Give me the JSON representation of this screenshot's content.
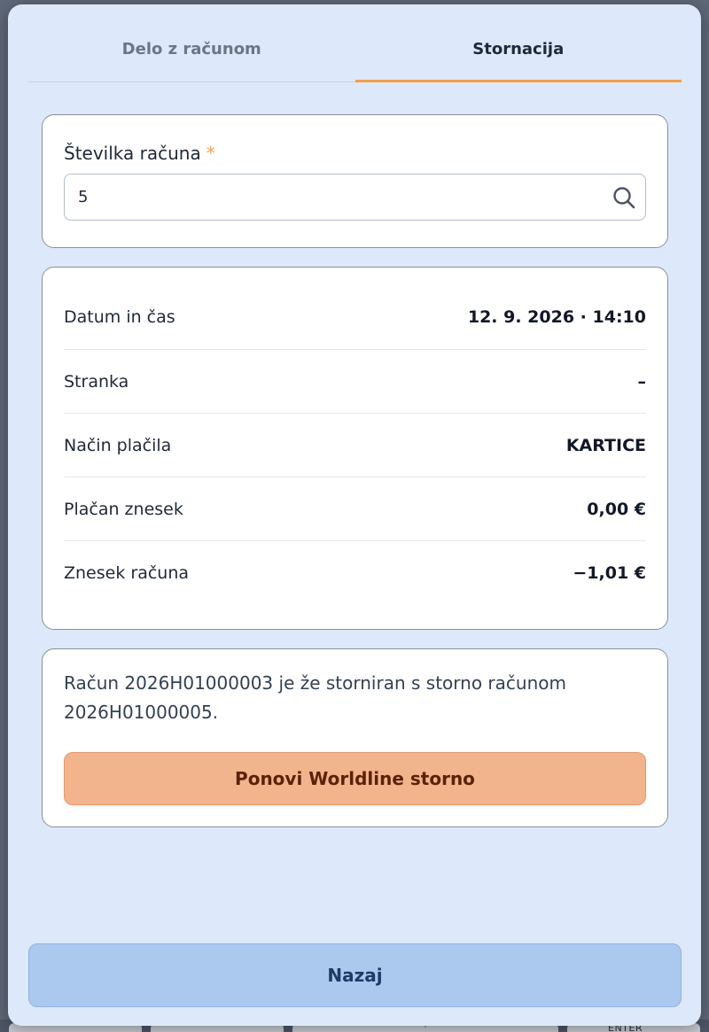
{
  "tabs": [
    {
      "label": "Delo z računom",
      "active": false
    },
    {
      "label": "Stornacija",
      "active": true
    }
  ],
  "search": {
    "label": "Številka računa",
    "required_mark": "*",
    "value": "5",
    "icon": "search-icon"
  },
  "details": {
    "rows": [
      {
        "label": "Datum in čas",
        "value": "12. 9. 2026 · 14:10"
      },
      {
        "label": "Stranka",
        "value": "–"
      },
      {
        "label": "Način plačila",
        "value": "KARTICE"
      },
      {
        "label": "Plačan znesek",
        "value": "0,00 €"
      },
      {
        "label": "Znesek računa",
        "value": "−1,01 €"
      }
    ]
  },
  "notice": {
    "text": "Račun 2026H01000003 je že storniran s storno računom 2026H01000005.",
    "retry_label": "Ponovi Worldline storno"
  },
  "footer": {
    "back_label": "Nazaj"
  },
  "backdrop": {
    "enter_hint": "ENTER"
  },
  "colors": {
    "accent": "#f0a04b",
    "modal_bg": "#dde9fa",
    "retry_bg": "#f2b48c",
    "back_bg": "#abc9ef"
  }
}
